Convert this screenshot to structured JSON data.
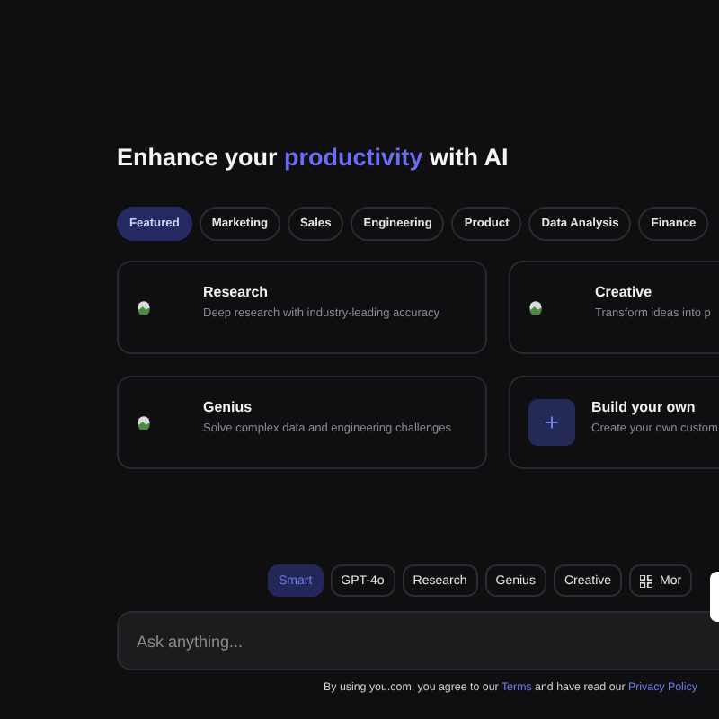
{
  "heading": {
    "before": "Enhance your ",
    "highlight": "productivity",
    "after": " with AI"
  },
  "categories": [
    {
      "label": "Featured",
      "selected": true
    },
    {
      "label": "Marketing",
      "selected": false
    },
    {
      "label": "Sales",
      "selected": false
    },
    {
      "label": "Engineering",
      "selected": false
    },
    {
      "label": "Product",
      "selected": false
    },
    {
      "label": "Data Analysis",
      "selected": false
    },
    {
      "label": "Finance",
      "selected": false
    }
  ],
  "cards": [
    {
      "kind": "image",
      "title": "Research",
      "description": "Deep research with industry-leading accuracy"
    },
    {
      "kind": "image",
      "title": "Creative",
      "description": "Transform ideas into p"
    },
    {
      "kind": "image",
      "title": "Genius",
      "description": "Solve complex data and engineering challenges"
    },
    {
      "kind": "add",
      "title": "Build your own",
      "description": "Create your own custom"
    }
  ],
  "modes": [
    {
      "label": "Smart",
      "selected": true,
      "kind": "text"
    },
    {
      "label": "GPT-4o",
      "selected": false,
      "kind": "text"
    },
    {
      "label": "Research",
      "selected": false,
      "kind": "text"
    },
    {
      "label": "Genius",
      "selected": false,
      "kind": "text"
    },
    {
      "label": "Creative",
      "selected": false,
      "kind": "text"
    },
    {
      "label": "Mor",
      "selected": false,
      "kind": "more"
    }
  ],
  "input": {
    "placeholder": "Ask anything..."
  },
  "footer": {
    "text": "By using you.com, you agree to our ",
    "link1": "Terms",
    "middle": " and have read our ",
    "link2": "Privacy Policy"
  }
}
